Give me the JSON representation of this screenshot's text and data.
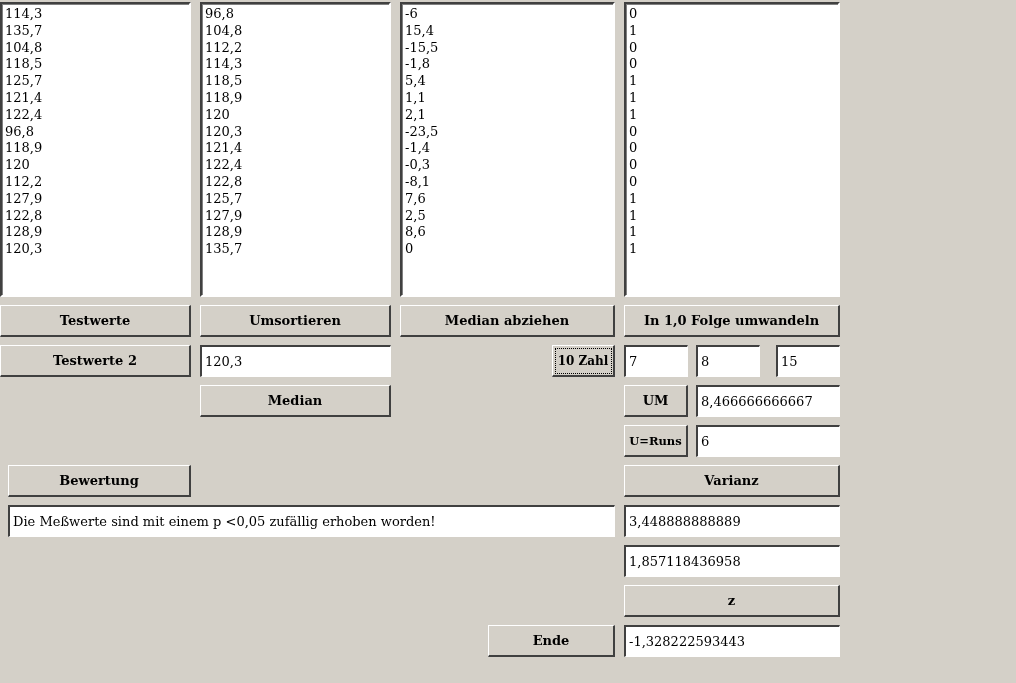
{
  "lists": [
    {
      "items": [
        "114,3",
        "135,7",
        "104,8",
        "118,5",
        "125,7",
        "121,4",
        "122,4",
        "96,8",
        "118,9",
        "120",
        "112,2",
        "127,9",
        "122,8",
        "128,9",
        "120,3"
      ]
    },
    {
      "items": [
        "96,8",
        "104,8",
        "112,2",
        "114,3",
        "118,5",
        "118,9",
        "120",
        "120,3",
        "121,4",
        "122,4",
        "122,8",
        "125,7",
        "127,9",
        "128,9",
        "135,7"
      ]
    },
    {
      "items": [
        "-6",
        "15,4",
        "-15,5",
        "-1,8",
        "5,4",
        "1,1",
        "2,1",
        "-23,5",
        "-1,4",
        "-0,3",
        "-8,1",
        "7,6",
        "2,5",
        "8,6",
        "0"
      ]
    },
    {
      "items": [
        "0",
        "1",
        "0",
        "0",
        "1",
        "1",
        "1",
        "0",
        "0",
        "0",
        "0",
        "1",
        "1",
        "1",
        "1"
      ]
    }
  ],
  "controls": [
    {
      "kind": "button",
      "label": "Testwerte",
      "focused": false
    },
    {
      "kind": "button",
      "label": "Umsortieren",
      "focused": false
    },
    {
      "kind": "button",
      "label": "Median abziehen",
      "focused": false
    },
    {
      "kind": "button",
      "label": "In 1,0 Folge umwandeln",
      "focused": false
    },
    {
      "kind": "button",
      "label": "Testwerte 2",
      "focused": false
    },
    {
      "kind": "field",
      "value": "120,3"
    },
    {
      "kind": "button",
      "label": "10 Zahl",
      "focused": true
    },
    {
      "kind": "field",
      "value": "7"
    },
    {
      "kind": "field",
      "value": "8"
    },
    {
      "kind": "field",
      "value": "15"
    },
    {
      "kind": "button",
      "label": "Median",
      "focused": false
    },
    {
      "kind": "button",
      "label": "UM",
      "focused": false
    },
    {
      "kind": "field",
      "value": "8,466666666667"
    },
    {
      "kind": "button",
      "label": "U=Runs",
      "focused": false
    },
    {
      "kind": "field",
      "value": "6"
    },
    {
      "kind": "button",
      "label": "Bewertung",
      "focused": false
    },
    {
      "kind": "button",
      "label": "Varianz",
      "focused": false
    },
    {
      "kind": "field",
      "value": "Die Meßwerte sind mit einem p <0,05 zufällig erhoben worden!"
    },
    {
      "kind": "field",
      "value": "3,448888888889"
    },
    {
      "kind": "field",
      "value": "1,857118436958"
    },
    {
      "kind": "button",
      "label": "z",
      "focused": false
    },
    {
      "kind": "button",
      "label": "Ende",
      "focused": false
    },
    {
      "kind": "field",
      "value": "-1,328222593443"
    }
  ]
}
